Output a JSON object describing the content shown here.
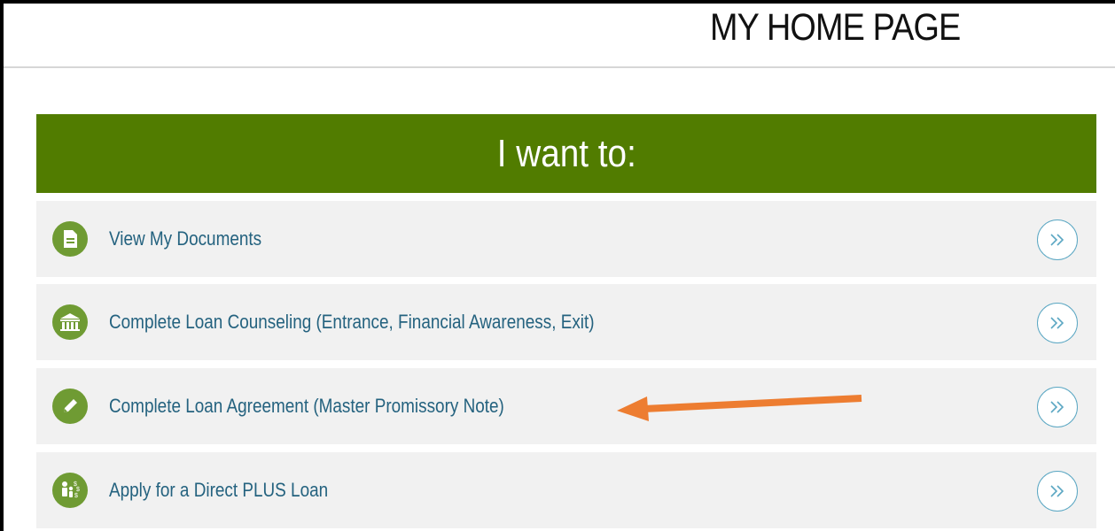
{
  "header": {
    "title": "MY HOME PAGE"
  },
  "panel": {
    "title": "I want to:",
    "accent_color": "#517c00",
    "items": [
      {
        "label": "View My Documents",
        "icon": "document-icon"
      },
      {
        "label": "Complete Loan Counseling (Entrance, Financial Awareness, Exit)",
        "icon": "institution-icon"
      },
      {
        "label": "Complete Loan Agreement (Master Promissory Note)",
        "icon": "pencil-icon"
      },
      {
        "label": "Apply for a Direct PLUS Loan",
        "icon": "family-money-icon"
      }
    ]
  },
  "annotation": {
    "arrow_color": "#ed7d31",
    "target": "Complete Loan Agreement (Master Promissory Note)"
  }
}
